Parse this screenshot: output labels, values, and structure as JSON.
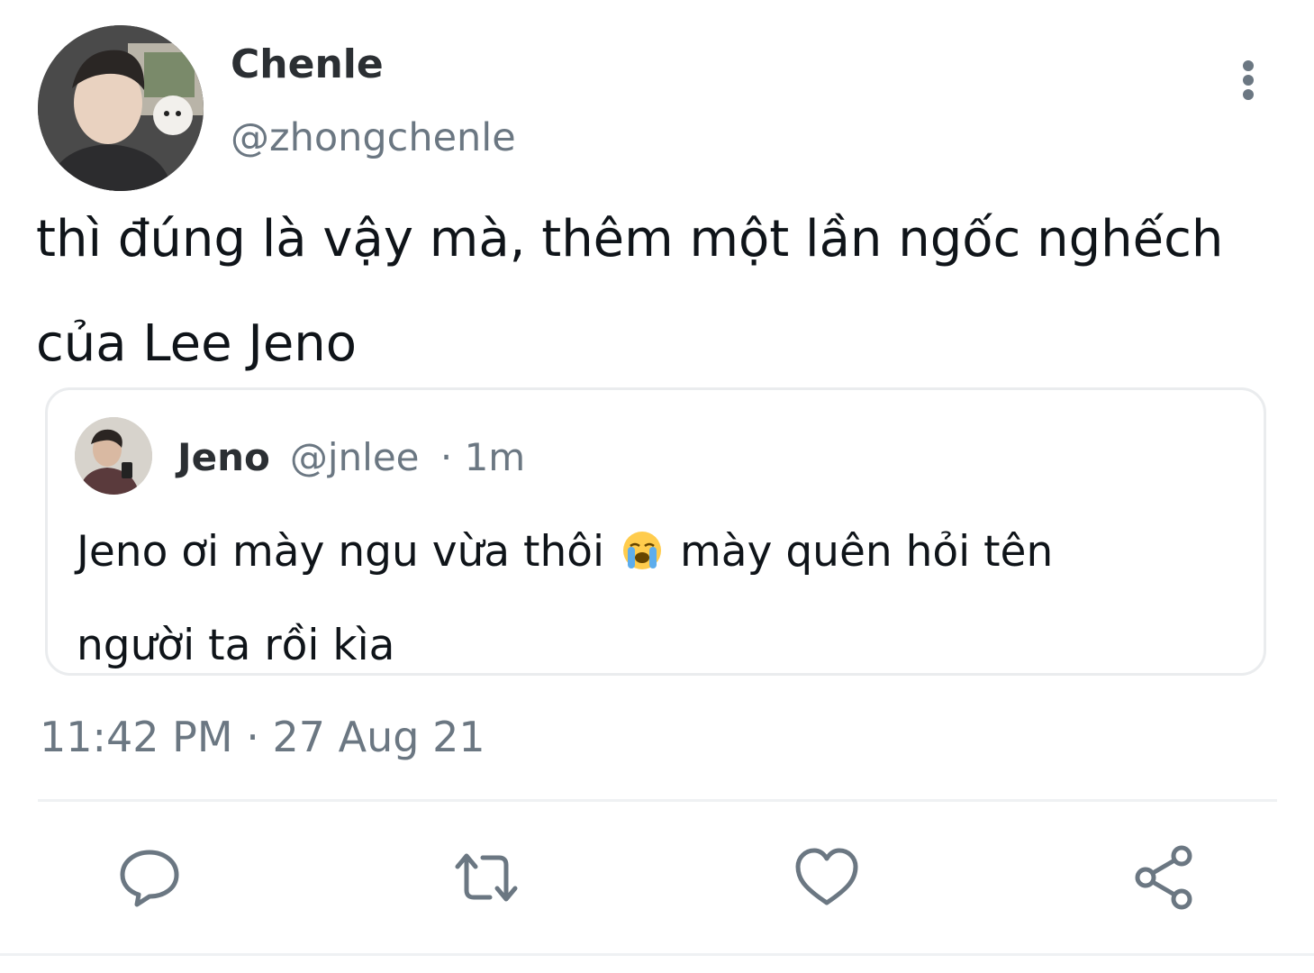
{
  "tweet": {
    "author": {
      "display_name": "Chenle",
      "handle": "@zhongchenle"
    },
    "text_lines": [
      "thì đúng là vậy mà, thêm một lần ngốc nghếch",
      "của Lee Jeno"
    ],
    "timestamp": "11:42 PM · 27 Aug 21",
    "more_icon": "more-vertical-icon"
  },
  "quoted": {
    "author": {
      "display_name": "Jeno",
      "handle": "@jnlee",
      "time": "· 1m"
    },
    "text_line1_before": "Jeno ơi mày ngu vừa thôi",
    "emoji": "loudly-crying-face-emoji",
    "text_line1_after": "mày quên hỏi tên",
    "text_line2": "người ta rồi kìa"
  },
  "actions": [
    {
      "icon": "reply-icon"
    },
    {
      "icon": "retweet-icon"
    },
    {
      "icon": "like-icon"
    },
    {
      "icon": "share-icon"
    }
  ],
  "colors": {
    "text_primary": "#0f1419",
    "text_secondary": "#6b7782",
    "border": "#eaecee",
    "icon": "#6b7782"
  }
}
